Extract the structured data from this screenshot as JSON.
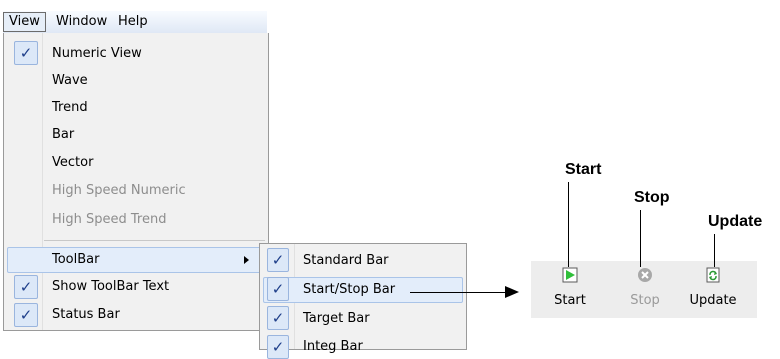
{
  "menubar": {
    "items": [
      {
        "label": "View"
      },
      {
        "label": "Window"
      },
      {
        "label": "Help"
      }
    ]
  },
  "view_menu": {
    "items": [
      {
        "label": "Numeric View",
        "checked": true,
        "enabled": true
      },
      {
        "label": "Wave",
        "checked": false,
        "enabled": true
      },
      {
        "label": "Trend",
        "checked": false,
        "enabled": true
      },
      {
        "label": "Bar",
        "checked": false,
        "enabled": true
      },
      {
        "label": "Vector",
        "checked": false,
        "enabled": true
      },
      {
        "label": "High Speed Numeric",
        "checked": false,
        "enabled": false
      },
      {
        "label": "High Speed Trend",
        "checked": false,
        "enabled": false
      },
      {
        "label": "ToolBar",
        "checked": false,
        "enabled": true,
        "has_submenu": true,
        "highlighted": true
      },
      {
        "label": "Show ToolBar Text",
        "checked": true,
        "enabled": true
      },
      {
        "label": "Status Bar",
        "checked": true,
        "enabled": true
      }
    ],
    "check_glyph": "✓"
  },
  "toolbar_submenu": {
    "items": [
      {
        "label": "Standard Bar",
        "checked": true
      },
      {
        "label": "Start/Stop Bar",
        "checked": true,
        "highlighted": true
      },
      {
        "label": "Target Bar",
        "checked": true
      },
      {
        "label": "Integ Bar",
        "checked": true,
        "partially_visible": true
      }
    ]
  },
  "toolbar": {
    "buttons": [
      {
        "label": "Start",
        "icon": "play-icon",
        "enabled": true
      },
      {
        "label": "Stop",
        "icon": "stop-icon",
        "enabled": false
      },
      {
        "label": "Update",
        "icon": "refresh-icon",
        "enabled": true
      }
    ]
  },
  "callouts": {
    "start": "Start",
    "stop": "Stop",
    "update": "Update"
  },
  "colors": {
    "highlight_bg": "#e3edfa",
    "check_bg": "#dce8f8",
    "play_green": "#2fbf3a"
  }
}
